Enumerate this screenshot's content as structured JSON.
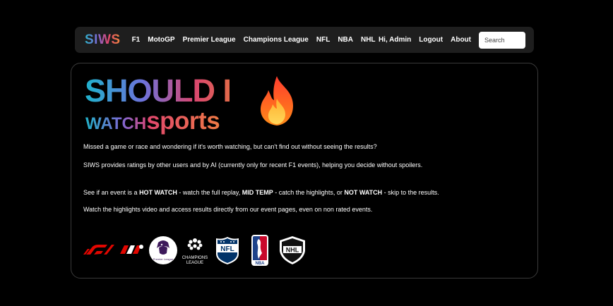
{
  "nav": {
    "brand": "SIWS",
    "links": [
      "F1",
      "MotoGP",
      "Premier League",
      "Champions League",
      "NFL",
      "NBA",
      "NHL"
    ],
    "greeting": "Hi, Admin",
    "logout": "Logout",
    "about": "About",
    "search_placeholder": "Search"
  },
  "hero": {
    "line1": "SHOULD I",
    "line2a": "WATCH",
    "line2b": "sports",
    "icon": "flame-icon"
  },
  "intro": {
    "p1": "Missed a game or race and wondering if it's worth watching, but can't find out without seeing the results?",
    "p2": "SIWS provides ratings by other users and by AI (currently only for recent F1 events), helping you decide without spoilers.",
    "p3_parts": [
      "See if an event is a ",
      "HOT WATCH",
      " - watch the full replay, ",
      "MID TEMP",
      " - catch the highlights, or ",
      "NOT WATCH",
      " - skip to the results."
    ],
    "p4": "Watch the highlights video and access results directly from our event pages, even on non rated events."
  },
  "logos": {
    "premier_text": "Premier League",
    "ucl_text_1": "CHAMPIONS",
    "ucl_text_2": "LEAGUE",
    "nfl_text": "NFL",
    "nba_text": "NBA",
    "nhl_text": "NHL"
  },
  "colors": {
    "background": "#000000",
    "navbar": "#1e1e1e",
    "card_border": "#3a3a3a",
    "f1_red": "#e10600",
    "nfl_blue": "#013369",
    "nba_red": "#c9082a"
  }
}
